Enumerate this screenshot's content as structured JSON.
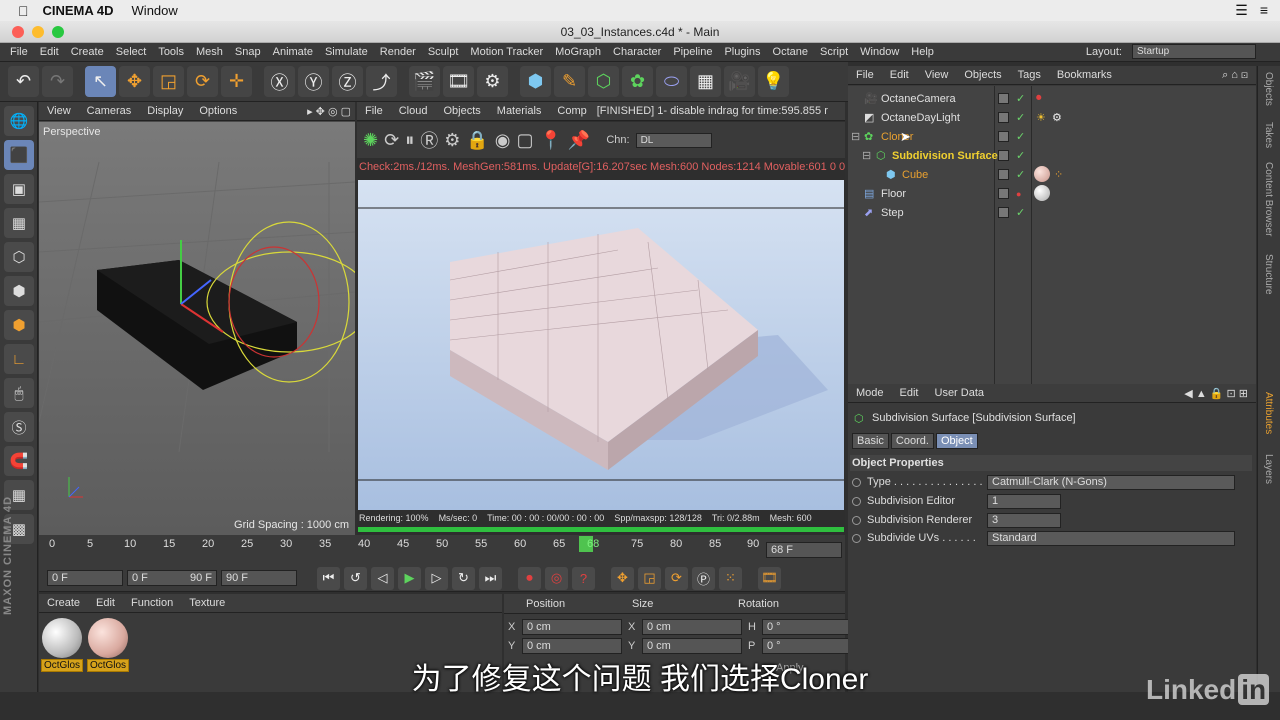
{
  "mac": {
    "app_name": "CINEMA 4D",
    "menu_window": "Window"
  },
  "window": {
    "title": "03_03_Instances.c4d * - Main"
  },
  "menu": {
    "items": [
      "File",
      "Edit",
      "Create",
      "Select",
      "Tools",
      "Mesh",
      "Snap",
      "Animate",
      "Simulate",
      "Render",
      "Sculpt",
      "Motion Tracker",
      "MoGraph",
      "Character",
      "Pipeline",
      "Plugins",
      "Octane",
      "Script",
      "Window",
      "Help"
    ],
    "layout_label": "Layout:",
    "layout_value": "Startup"
  },
  "viewport": {
    "menu": [
      "View",
      "Cameras",
      "Display",
      "Options"
    ],
    "label": "Perspective",
    "grid_spacing": "Grid Spacing : 1000 cm"
  },
  "octane_viewer": {
    "menu": [
      "File",
      "Cloud",
      "Objects",
      "Materials",
      "Comp"
    ],
    "finished_msg": "[FINISHED] 1- disable indrag for time:595.855 r",
    "channel_label": "Chn:",
    "channel_value": "DL",
    "status": "Check:2ms./12ms. MeshGen:581ms. Update[G]:16.207sec Mesh:600 Nodes:1214 Movable:601 0 0",
    "render_stats": [
      "Rendering: 100%",
      "Ms/sec: 0",
      "Time: 00 : 00 : 00/00 : 00 : 00",
      "Spp/maxspp: 128/128",
      "Tri: 0/2.88m",
      "Mesh: 600"
    ]
  },
  "timeline": {
    "ticks": [
      "0",
      "5",
      "10",
      "15",
      "20",
      "25",
      "30",
      "35",
      "40",
      "45",
      "50",
      "55",
      "60",
      "65",
      "68",
      "75",
      "80",
      "85",
      "90"
    ],
    "current": "68 F"
  },
  "transport": {
    "start": "0 F",
    "range_start": "0 F",
    "range_end": "90 F",
    "end": "90 F"
  },
  "materials": {
    "menu": [
      "Create",
      "Edit",
      "Function",
      "Texture"
    ],
    "items": [
      {
        "label": "OctGlos"
      },
      {
        "label": "OctGlos"
      }
    ]
  },
  "coordinates": {
    "headers": [
      "Position",
      "Size",
      "Rotation"
    ],
    "rows": [
      {
        "a": "X",
        "v1": "0 cm",
        "b": "X",
        "v2": "0 cm",
        "c": "H",
        "v3": "0 °"
      },
      {
        "a": "Y",
        "v1": "0 cm",
        "b": "Y",
        "v2": "0 cm",
        "c": "P",
        "v3": "0 °"
      }
    ],
    "apply": "Apply"
  },
  "object_manager": {
    "menu": [
      "File",
      "Edit",
      "View",
      "Objects",
      "Tags",
      "Bookmarks"
    ],
    "objects": [
      {
        "name": "OctaneCamera",
        "indent": 0
      },
      {
        "name": "OctaneDayLight",
        "indent": 0
      },
      {
        "name": "Cloner",
        "indent": 0
      },
      {
        "name": "Subdivision Surface",
        "indent": 1
      },
      {
        "name": "Cube",
        "indent": 2
      },
      {
        "name": "Floor",
        "indent": 0
      },
      {
        "name": "Step",
        "indent": 0
      }
    ]
  },
  "attributes": {
    "menu": [
      "Mode",
      "Edit",
      "User Data"
    ],
    "title": "Subdivision Surface [Subdivision Surface]",
    "tabs": [
      "Basic",
      "Coord.",
      "Object"
    ],
    "section": "Object Properties",
    "props": [
      {
        "label": "Type . . . . . . . . . . . . . . .",
        "value": "Catmull-Clark (N-Gons)"
      },
      {
        "label": "Subdivision Editor",
        "value": "1"
      },
      {
        "label": "Subdivision Renderer",
        "value": "3"
      },
      {
        "label": "Subdivide UVs . . . . . .",
        "value": "Standard"
      }
    ]
  },
  "side_tabs": [
    "Objects",
    "Takes",
    "Content Browser",
    "Structure",
    "Attributes",
    "Layers"
  ],
  "branding": {
    "maxon": "MAXON CINEMA 4D",
    "linkedin": "Linked",
    "linkedin_in": "in"
  },
  "subtitle": "为了修复这个问题 我们选择Cloner"
}
